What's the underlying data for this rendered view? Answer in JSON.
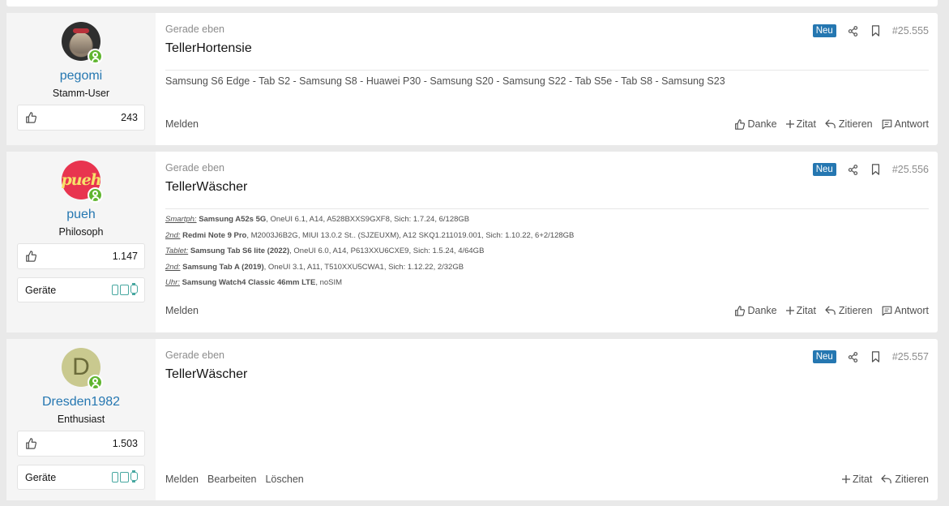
{
  "posts": [
    {
      "user": {
        "name": "pegomi",
        "title": "Stamm-User",
        "likes": "243",
        "avatar": "cat-icon"
      },
      "date": "Gerade eben",
      "title": "TellerHortensie",
      "badge": "Neu",
      "number": "#25.555",
      "signature": "Samsung S6 Edge - Tab S2 - Samsung S8 - Huawei P30 - Samsung S20 - Samsung S22 - Tab S5e - Tab S8 - Samsung S23",
      "actions_left": [
        "Melden"
      ],
      "actions_right": [
        "Danke",
        "Zitat",
        "Zitieren",
        "Antwort"
      ]
    },
    {
      "user": {
        "name": "pueh",
        "title": "Philosoph",
        "likes": "1.147",
        "devices_label": "Geräte",
        "avatar_text": "pueh"
      },
      "date": "Gerade eben",
      "title": "TellerWäscher",
      "badge": "Neu",
      "number": "#25.556",
      "sig_lines": [
        {
          "label": "Smartph:",
          "bold": "Samsung A52s 5G",
          "rest": ", OneUI 6.1, A14, A528BXXS9GXF8, Sich: 1.7.24, 6/128GB"
        },
        {
          "label": "2nd:",
          "bold": "Redmi Note 9 Pro",
          "rest": ", M2003J6B2G, MIUI 13.0.2 St.. (SJZEUXM), A12 SKQ1.211019.001, Sich: 1.10.22, 6+2/128GB"
        },
        {
          "label": "Tablet:",
          "bold": "Samsung Tab S6 lite (2022)",
          "rest": ", OneUI 6.0, A14, P613XXU6CXE9, Sich: 1.5.24, 4/64GB"
        },
        {
          "label": "2nd:",
          "bold": "Samsung Tab A (2019)",
          "rest": ", OneUI 3.1, A11, T510XXU5CWA1, Sich: 1.12.22, 2/32GB"
        },
        {
          "label": "Uhr:",
          "bold": "Samsung Watch4 Classic 46mm LTE",
          "rest": ", noSIM"
        }
      ],
      "actions_left": [
        "Melden"
      ],
      "actions_right": [
        "Danke",
        "Zitat",
        "Zitieren",
        "Antwort"
      ]
    },
    {
      "user": {
        "name": "Dresden1982",
        "title": "Enthusiast",
        "likes": "1.503",
        "devices_label": "Geräte",
        "avatar_text": "D"
      },
      "date": "Gerade eben",
      "title": "TellerWäscher",
      "badge": "Neu",
      "number": "#25.557",
      "actions_left": [
        "Melden",
        "Bearbeiten",
        "Löschen"
      ],
      "actions_right": [
        "Zitat",
        "Zitieren"
      ]
    }
  ],
  "colors": {
    "link": "#2577b1",
    "badge": "#2577b1",
    "online": "#5fb52f",
    "device": "#47a7a0"
  }
}
